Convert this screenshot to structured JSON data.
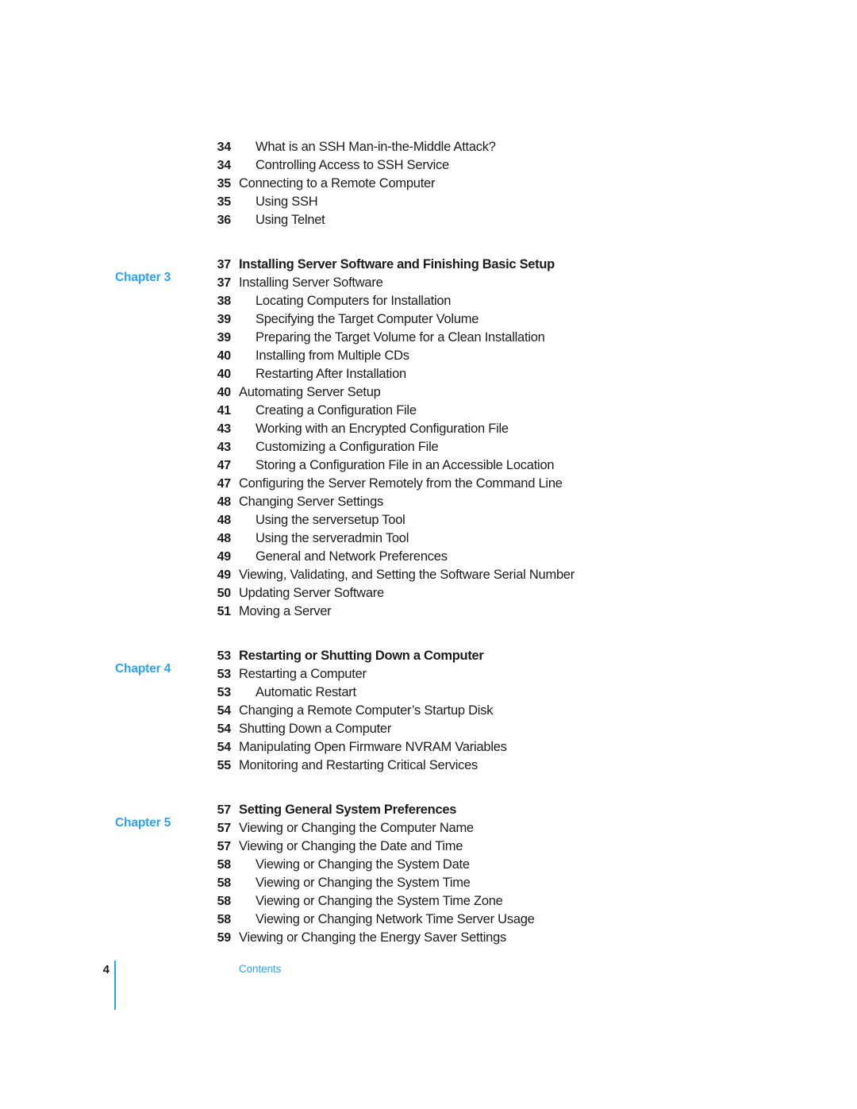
{
  "document": {
    "section_name": "Contents",
    "page_number": "4",
    "accent_color": "#2BA2F2",
    "text_color": "#1c1c1c"
  },
  "toc": {
    "entries": [
      {
        "chapter_label": "",
        "page": "34",
        "title": "What is an SSH Man-in-the-Middle Attack?",
        "level": 2,
        "gap_before": false
      },
      {
        "chapter_label": "",
        "page": "34",
        "title": "Controlling Access to SSH Service",
        "level": 2,
        "gap_before": false
      },
      {
        "chapter_label": "",
        "page": "35",
        "title": "Connecting to a Remote Computer",
        "level": 1,
        "gap_before": false
      },
      {
        "chapter_label": "",
        "page": "35",
        "title": "Using SSH",
        "level": 2,
        "gap_before": false
      },
      {
        "chapter_label": "",
        "page": "36",
        "title": "Using Telnet",
        "level": 2,
        "gap_before": false
      },
      {
        "chapter_label": "Chapter 3",
        "page": "37",
        "title": "Installing Server Software and Finishing Basic Setup",
        "level": 0,
        "gap_before": true
      },
      {
        "chapter_label": "",
        "page": "37",
        "title": "Installing Server Software",
        "level": 1,
        "gap_before": false
      },
      {
        "chapter_label": "",
        "page": "38",
        "title": "Locating Computers for Installation",
        "level": 2,
        "gap_before": false
      },
      {
        "chapter_label": "",
        "page": "39",
        "title": "Specifying the Target Computer Volume",
        "level": 2,
        "gap_before": false
      },
      {
        "chapter_label": "",
        "page": "39",
        "title": "Preparing the Target Volume for a Clean Installation",
        "level": 2,
        "gap_before": false
      },
      {
        "chapter_label": "",
        "page": "40",
        "title": "Installing from Multiple CDs",
        "level": 2,
        "gap_before": false
      },
      {
        "chapter_label": "",
        "page": "40",
        "title": "Restarting After Installation",
        "level": 2,
        "gap_before": false
      },
      {
        "chapter_label": "",
        "page": "40",
        "title": "Automating Server Setup",
        "level": 1,
        "gap_before": false
      },
      {
        "chapter_label": "",
        "page": "41",
        "title": "Creating a Configuration File",
        "level": 2,
        "gap_before": false
      },
      {
        "chapter_label": "",
        "page": "43",
        "title": "Working with an Encrypted Configuration File",
        "level": 2,
        "gap_before": false
      },
      {
        "chapter_label": "",
        "page": "43",
        "title": "Customizing a Configuration File",
        "level": 2,
        "gap_before": false
      },
      {
        "chapter_label": "",
        "page": "47",
        "title": "Storing a Configuration File in an Accessible Location",
        "level": 2,
        "gap_before": false
      },
      {
        "chapter_label": "",
        "page": "47",
        "title": "Configuring the Server Remotely from the Command Line",
        "level": 1,
        "gap_before": false
      },
      {
        "chapter_label": "",
        "page": "48",
        "title": "Changing Server Settings",
        "level": 1,
        "gap_before": false
      },
      {
        "chapter_label": "",
        "page": "48",
        "title": "Using the serversetup Tool",
        "level": 2,
        "gap_before": false
      },
      {
        "chapter_label": "",
        "page": "48",
        "title": "Using the serveradmin Tool",
        "level": 2,
        "gap_before": false
      },
      {
        "chapter_label": "",
        "page": "49",
        "title": "General and Network Preferences",
        "level": 2,
        "gap_before": false
      },
      {
        "chapter_label": "",
        "page": "49",
        "title": "Viewing, Validating, and Setting the Software Serial Number",
        "level": 1,
        "gap_before": false
      },
      {
        "chapter_label": "",
        "page": "50",
        "title": "Updating Server Software",
        "level": 1,
        "gap_before": false
      },
      {
        "chapter_label": "",
        "page": "51",
        "title": "Moving a Server",
        "level": 1,
        "gap_before": false
      },
      {
        "chapter_label": "Chapter 4",
        "page": "53",
        "title": "Restarting or Shutting Down a Computer",
        "level": 0,
        "gap_before": true
      },
      {
        "chapter_label": "",
        "page": "53",
        "title": "Restarting a Computer",
        "level": 1,
        "gap_before": false
      },
      {
        "chapter_label": "",
        "page": "53",
        "title": "Automatic Restart",
        "level": 2,
        "gap_before": false
      },
      {
        "chapter_label": "",
        "page": "54",
        "title": "Changing a Remote Computer’s Startup Disk",
        "level": 1,
        "gap_before": false
      },
      {
        "chapter_label": "",
        "page": "54",
        "title": "Shutting Down a Computer",
        "level": 1,
        "gap_before": false
      },
      {
        "chapter_label": "",
        "page": "54",
        "title": "Manipulating Open Firmware NVRAM Variables",
        "level": 1,
        "gap_before": false
      },
      {
        "chapter_label": "",
        "page": "55",
        "title": "Monitoring and Restarting Critical Services",
        "level": 1,
        "gap_before": false
      },
      {
        "chapter_label": "Chapter 5",
        "page": "57",
        "title": "Setting General System Preferences",
        "level": 0,
        "gap_before": true
      },
      {
        "chapter_label": "",
        "page": "57",
        "title": "Viewing or Changing the Computer Name",
        "level": 1,
        "gap_before": false
      },
      {
        "chapter_label": "",
        "page": "57",
        "title": "Viewing or Changing the Date and Time",
        "level": 1,
        "gap_before": false
      },
      {
        "chapter_label": "",
        "page": "58",
        "title": "Viewing or Changing the System Date",
        "level": 2,
        "gap_before": false
      },
      {
        "chapter_label": "",
        "page": "58",
        "title": "Viewing or Changing the System Time",
        "level": 2,
        "gap_before": false
      },
      {
        "chapter_label": "",
        "page": "58",
        "title": "Viewing or Changing the System Time Zone",
        "level": 2,
        "gap_before": false
      },
      {
        "chapter_label": "",
        "page": "58",
        "title": "Viewing or Changing Network Time Server Usage",
        "level": 2,
        "gap_before": false
      },
      {
        "chapter_label": "",
        "page": "59",
        "title": "Viewing or Changing the Energy Saver Settings",
        "level": 1,
        "gap_before": false
      }
    ]
  }
}
